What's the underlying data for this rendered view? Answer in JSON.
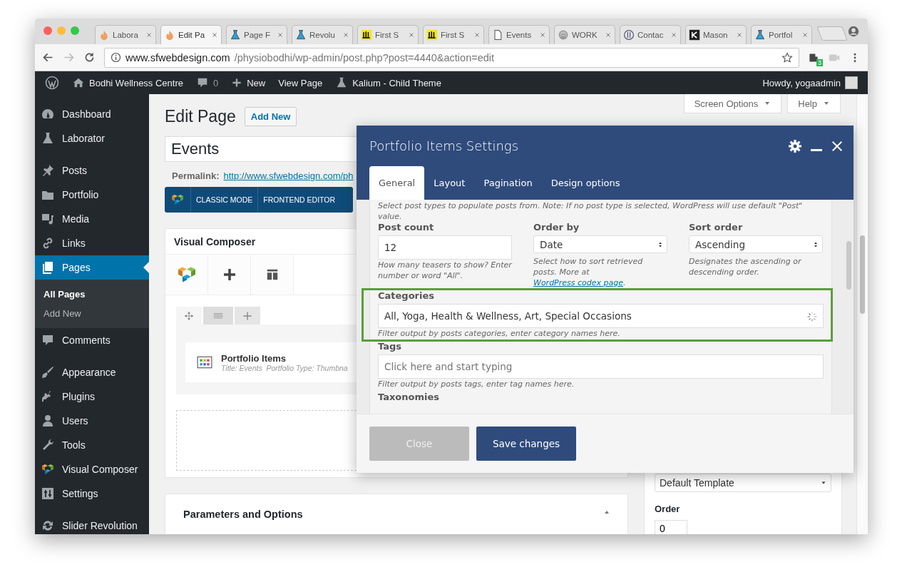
{
  "browser": {
    "tabs": [
      {
        "title": "Labora",
        "selected": false
      },
      {
        "title": "Edit Pa",
        "selected": true
      },
      {
        "title": "Page F",
        "selected": false
      },
      {
        "title": "Revolu",
        "selected": false
      },
      {
        "title": "First S",
        "selected": false
      },
      {
        "title": "First S",
        "selected": false
      },
      {
        "title": "Events",
        "selected": false
      },
      {
        "title": "WORK",
        "selected": false
      },
      {
        "title": "Contac",
        "selected": false
      },
      {
        "title": "Mason",
        "selected": false
      },
      {
        "title": "Portfol",
        "selected": false
      }
    ],
    "address": {
      "host": "www.sfwebdesign.com",
      "path": "/physiobodhi/wp-admin/post.php?post=4440&action=edit"
    },
    "extension_badge": "3"
  },
  "admin_bar": {
    "site": "Bodhi Wellness Centre",
    "comments": "0",
    "new": "New",
    "view": "View Page",
    "theme": "Kalium - Child Theme",
    "greeting": "Howdy, yogaadmin"
  },
  "sidebar": {
    "groups": [
      {
        "items": [
          {
            "label": "Dashboard",
            "selected": false
          },
          {
            "label": "Laborator",
            "selected": false
          }
        ]
      },
      {
        "items": [
          {
            "label": "Posts",
            "selected": false
          },
          {
            "label": "Portfolio",
            "selected": false
          },
          {
            "label": "Media",
            "selected": false
          },
          {
            "label": "Links",
            "selected": false
          },
          {
            "label": "Pages",
            "selected": true,
            "children": [
              {
                "label": "All Pages",
                "selected": true
              },
              {
                "label": "Add New",
                "selected": false
              }
            ]
          },
          {
            "label": "Comments",
            "selected": false
          }
        ]
      },
      {
        "items": [
          {
            "label": "Appearance",
            "selected": false
          },
          {
            "label": "Plugins",
            "selected": false
          },
          {
            "label": "Users",
            "selected": false
          },
          {
            "label": "Tools",
            "selected": false
          },
          {
            "label": "Visual Composer",
            "selected": false
          },
          {
            "label": "Settings",
            "selected": false
          }
        ]
      },
      {
        "items": [
          {
            "label": "Slider Revolution",
            "selected": false
          }
        ]
      }
    ]
  },
  "screen_meta": [
    "Screen Options",
    "Help"
  ],
  "page": {
    "heading": "Edit Page",
    "add_new": "Add New",
    "title_value": "Events",
    "permalink_label": "Permalink:",
    "permalink_url": "http://www.sfwebdesign.com/ph",
    "editor_buttons": [
      "CLASSIC MODE",
      "FRONTEND EDITOR"
    ],
    "composer": {
      "title": "Visual Composer",
      "element": {
        "name": "Portfolio Items",
        "summary": "Title: Events  Portfolio Type: Thumbna"
      }
    },
    "parameters_title": "Parameters and Options",
    "attributes": {
      "template": "Default Template",
      "order_label": "Order",
      "order_value": "0"
    }
  },
  "dialog": {
    "title": "Portfolio Items Settings",
    "tabs": [
      {
        "label": "General",
        "selected": true
      },
      {
        "label": "Layout",
        "selected": false
      },
      {
        "label": "Pagination",
        "selected": false
      },
      {
        "label": "Design options",
        "selected": false
      }
    ],
    "intro": "Select post types to populate posts from. Note: If no post type is selected, WordPress will use default \"Post\" value.",
    "columns": [
      {
        "kind": "text",
        "label": "Post count",
        "value": "12",
        "help": "How many teasers to show? Enter number or word \"All\"."
      },
      {
        "kind": "select",
        "label": "Order by",
        "value": "Date",
        "help": "Select how to sort retrieved posts. More at ",
        "link": "WordPress codex page",
        "help_end": "."
      },
      {
        "kind": "select",
        "label": "Sort order",
        "value": "Ascending",
        "help": "Designates the ascending or descending order."
      }
    ],
    "rows": [
      {
        "kind": "text",
        "label": "Categories",
        "value": "All, Yoga, Health & Wellness, Art, Special Occasions",
        "help": "Filter output by posts categories, enter category names here.",
        "highlighted": true,
        "loading": true
      },
      {
        "kind": "text",
        "label": "Tags",
        "placeholder": "Click here and start typing",
        "help": "Filter output by posts tags, enter tag names here.",
        "highlighted": false,
        "loading": false
      },
      {
        "kind": "label",
        "label": "Taxonomies"
      }
    ],
    "buttons": [
      {
        "label": "Close",
        "kind": "secondary"
      },
      {
        "label": "Save changes",
        "kind": "primary"
      }
    ]
  }
}
